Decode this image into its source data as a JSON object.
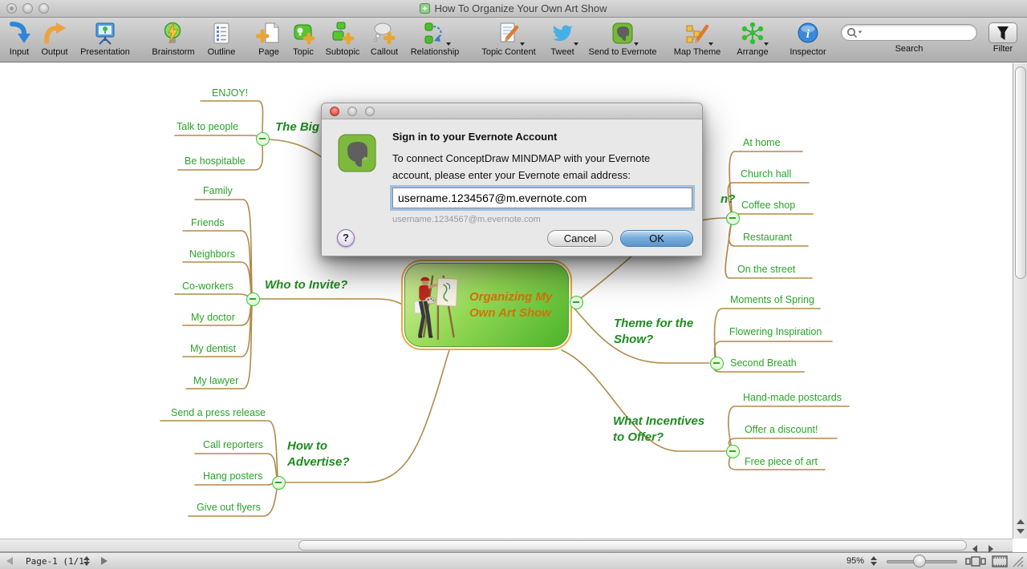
{
  "window": {
    "title": "How To Organize Your Own Art Show"
  },
  "toolbar": {
    "items": [
      {
        "label": "Input"
      },
      {
        "label": "Output"
      },
      {
        "label": "Presentation"
      },
      {
        "label": "Brainstorm"
      },
      {
        "label": "Outline"
      },
      {
        "label": "Page"
      },
      {
        "label": "Topic"
      },
      {
        "label": "Subtopic"
      },
      {
        "label": "Callout"
      },
      {
        "label": "Relationship"
      },
      {
        "label": "Topic Content"
      },
      {
        "label": "Tweet"
      },
      {
        "label": "Send to Evernote"
      },
      {
        "label": "Map Theme"
      },
      {
        "label": "Arrange"
      },
      {
        "label": "Inspector"
      }
    ],
    "search_label": "Search",
    "filter_label": "Filter"
  },
  "dialog": {
    "title": "Sign in to your Evernote Account",
    "body_line1": "To connect ConceptDraw MINDMAP with your Evernote",
    "body_line2": "account, please enter your Evernote email address:",
    "email_value": "username.1234567@m.evernote.com",
    "email_hint": "username.1234567@m.evernote.com",
    "help_label": "?",
    "cancel_label": "Cancel",
    "ok_label": "OK"
  },
  "mindmap": {
    "central": {
      "line1": "Organizing My",
      "line2": "Own Art Show"
    },
    "branches": [
      {
        "label": "The Big",
        "subtopics": [
          "ENJOY!",
          "Talk to people",
          "Be hospitable"
        ]
      },
      {
        "label": "Who to Invite?",
        "subtopics": [
          "Family",
          "Friends",
          "Neighbors",
          "Co-workers",
          "My doctor",
          "My dentist",
          "My lawyer"
        ]
      },
      {
        "label1": "How to",
        "label2": "Advertise?",
        "subtopics": [
          "Send a press release",
          "Call reporters",
          "Hang posters",
          "Give out flyers"
        ]
      },
      {
        "label": "n?",
        "subtopics": [
          "At home",
          "Church hall",
          "Coffee shop",
          "Restaurant",
          "On the street"
        ]
      },
      {
        "label1": "Theme for the",
        "label2": "Show?",
        "subtopics": [
          "Moments of Spring",
          "Flowering Inspiration",
          "Second Breath"
        ]
      },
      {
        "label1": "What Incentives",
        "label2": "to Offer?",
        "subtopics": [
          "Hand-made postcards",
          "Offer a discount!",
          "Free piece of art"
        ]
      }
    ]
  },
  "statusbar": {
    "page": "Page-1 (1/1)",
    "zoom": "95%"
  },
  "colors": {
    "topic_green": "#1e8c1e",
    "subtopic_green": "#2aa32a",
    "branch_line_tan": "#b08a4a",
    "central_text_orange": "#d2720a",
    "selection_orange": "#f2a93a",
    "ok_button_blue": "#79aede",
    "evernote_green": "#74b937"
  }
}
